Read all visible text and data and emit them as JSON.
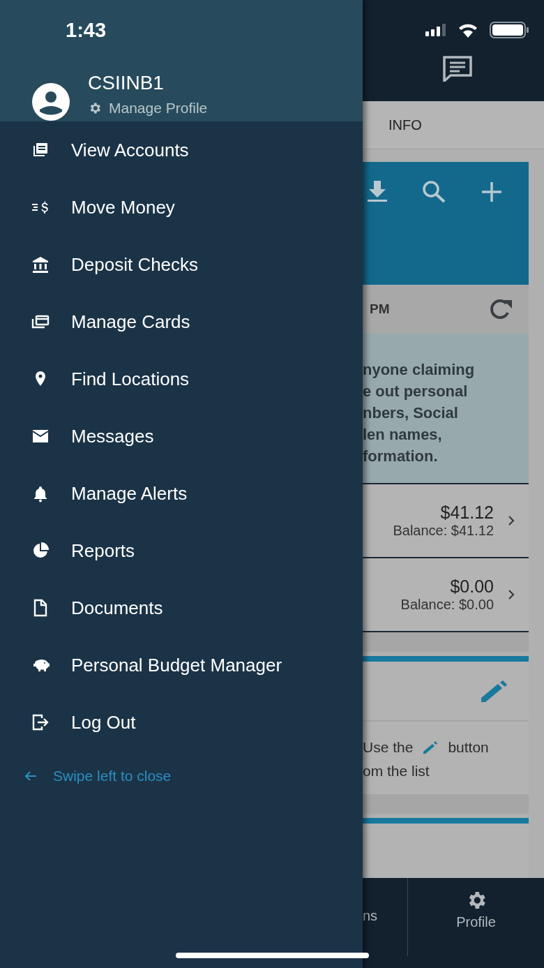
{
  "status_bar": {
    "time": "1:43"
  },
  "profile": {
    "name": "CSIINB1",
    "link": "Manage Profile"
  },
  "menu": [
    {
      "label": "View Accounts"
    },
    {
      "label": "Move Money"
    },
    {
      "label": "Deposit Checks"
    },
    {
      "label": "Manage Cards"
    },
    {
      "label": "Find Locations"
    },
    {
      "label": "Messages"
    },
    {
      "label": "Manage Alerts"
    },
    {
      "label": "Reports"
    },
    {
      "label": "Documents"
    },
    {
      "label": "Personal Budget Manager"
    },
    {
      "label": "Log Out"
    }
  ],
  "close_hint": "Swipe left to close",
  "background": {
    "tab": "INFO",
    "sync_time": "PM",
    "notice": [
      "nyone claiming",
      "e out personal",
      "nbers, Social",
      "len names,",
      "formation."
    ],
    "accounts": [
      {
        "amount": "$41.12",
        "balance": "Balance: $41.12"
      },
      {
        "amount": "$0.00",
        "balance": "Balance: $0.00"
      }
    ],
    "instruction": {
      "before": "Use the",
      "after": "button",
      "line_2": "om the list"
    },
    "nav": [
      {
        "label": "ns"
      },
      {
        "label": "Profile"
      }
    ]
  }
}
